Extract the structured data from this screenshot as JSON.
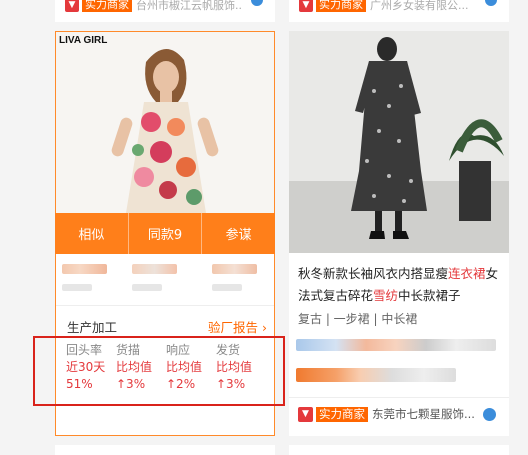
{
  "top_left": {
    "tag": "实力商家",
    "name": "台州市椒江云帆服饰..."
  },
  "top_right": {
    "tag": "实力商家",
    "name": "广州乡女装有限公..."
  },
  "left_card": {
    "brand": "LIVA GIRL",
    "actions": [
      "相似",
      "同款9",
      "参谋"
    ],
    "section_title": "生产加工",
    "report_link": "验厂报告 ›",
    "stats": [
      {
        "label": "回头率",
        "sub": "近30天",
        "value": "51%"
      },
      {
        "label": "货描",
        "sub": "比均值",
        "value": "↑3%"
      },
      {
        "label": "响应",
        "sub": "比均值",
        "value": "↑2%"
      },
      {
        "label": "发货",
        "sub": "比均值",
        "value": "↑3%"
      }
    ]
  },
  "right_card": {
    "title_line1_a": "秋冬新款长袖风衣内搭显瘦",
    "title_line1_b": "连衣裙",
    "title_line1_c": "女",
    "title_line2_a": "法式复古碎花",
    "title_line2_b": "雪纺",
    "title_line2_c": "中长款裙子",
    "tags": "复古 | 一步裙 | 中长裙",
    "seller_tag": "实力商家",
    "seller_name": "东莞市七颗星服饰..."
  },
  "colors": {
    "accent": "#ff7f1a",
    "red": "#e4393c",
    "highlight_box": "#d9231b"
  }
}
